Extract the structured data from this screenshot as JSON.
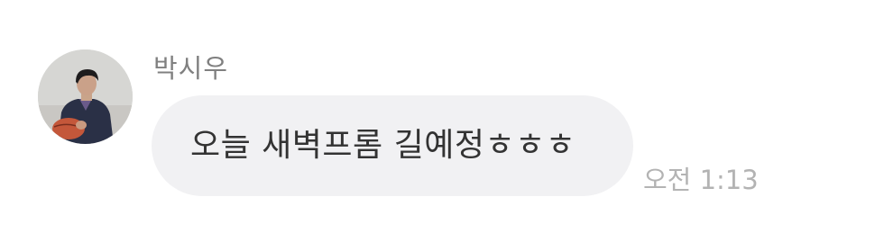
{
  "message": {
    "sender_name": "박시우",
    "text": "오늘 새벽프롬 길예정ㅎㅎㅎ",
    "time": "오전 1:13",
    "avatar_icon": "profile-photo",
    "bubble_color": "#f1f1f3"
  }
}
